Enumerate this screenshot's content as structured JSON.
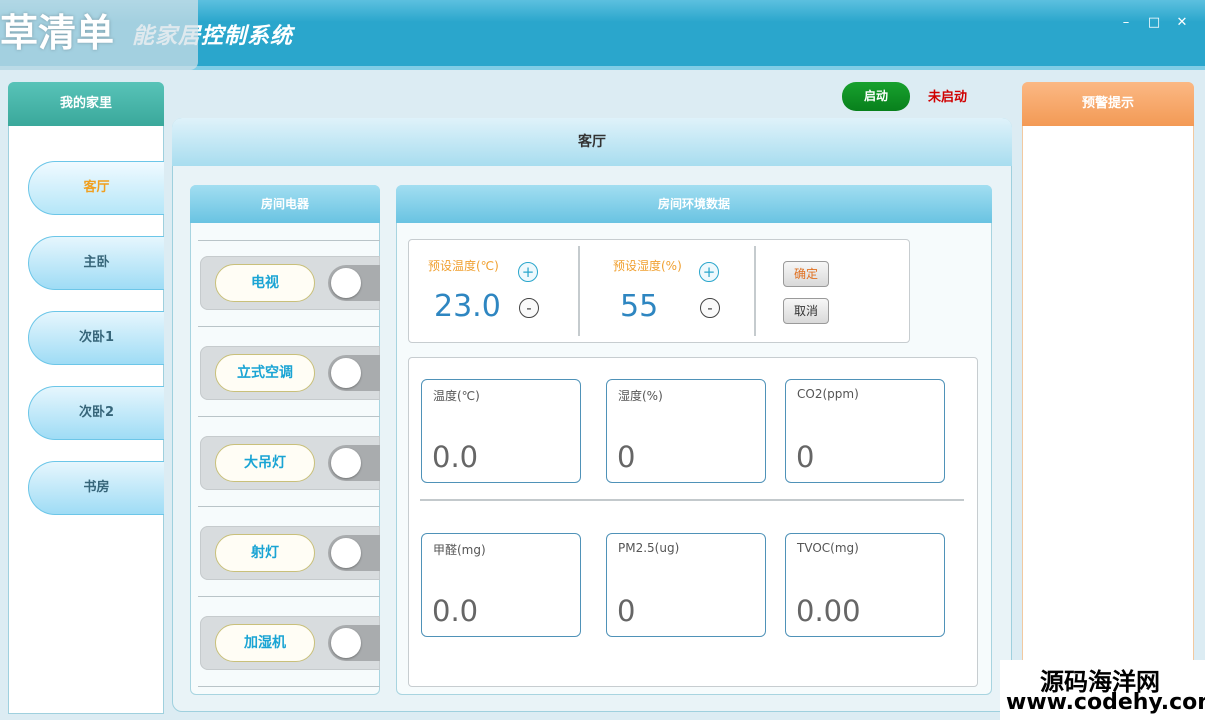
{
  "window": {
    "title": "智能家居控制系统",
    "title_visible": "能家居控制系统",
    "controls": {
      "minimize": "–",
      "maximize": "□",
      "close": "✕"
    }
  },
  "watermark": {
    "top_left": "草清单",
    "site_name": "源码海洋网",
    "site_url": "www.codehy.com"
  },
  "sidebar": {
    "title": "我的家里",
    "rooms": [
      {
        "label": "客厅",
        "active": true
      },
      {
        "label": "主卧",
        "active": false
      },
      {
        "label": "次卧1",
        "active": false
      },
      {
        "label": "次卧2",
        "active": false
      },
      {
        "label": "书房",
        "active": false
      }
    ]
  },
  "status": {
    "start_label": "启动",
    "state_text": "未启动"
  },
  "room": {
    "title": "客厅"
  },
  "appliances": {
    "title": "房间电器",
    "items": [
      {
        "label": "电视",
        "on": false
      },
      {
        "label": "立式空调",
        "on": false
      },
      {
        "label": "大吊灯",
        "on": false
      },
      {
        "label": "射灯",
        "on": false
      },
      {
        "label": "加湿机",
        "on": false
      }
    ]
  },
  "environment": {
    "title": "房间环境数据",
    "preset": {
      "temp_label": "预设温度(℃)",
      "temp_value": "23.0",
      "humidity_label": "预设湿度(%)",
      "humidity_value": "55",
      "plus_symbol": "+",
      "minus_symbol": "-",
      "confirm_label": "确定",
      "cancel_label": "取消"
    },
    "readings": [
      {
        "label": "温度(℃)",
        "value": "0.0"
      },
      {
        "label": "湿度(%)",
        "value": "0"
      },
      {
        "label": "CO2(ppm)",
        "value": "0"
      },
      {
        "label": "甲醛(mg)",
        "value": "0.0"
      },
      {
        "label": "PM2.5(ug)",
        "value": "0"
      },
      {
        "label": "TVOC(mg)",
        "value": "0.00"
      }
    ]
  },
  "alerts": {
    "title": "预警提示",
    "items": []
  },
  "colors": {
    "titlebar": "#2aa6cc",
    "start_button": "#0d8a22",
    "state_text": "#d00000",
    "alert_header": "#f39a55",
    "accent_orange": "#f0a030"
  }
}
